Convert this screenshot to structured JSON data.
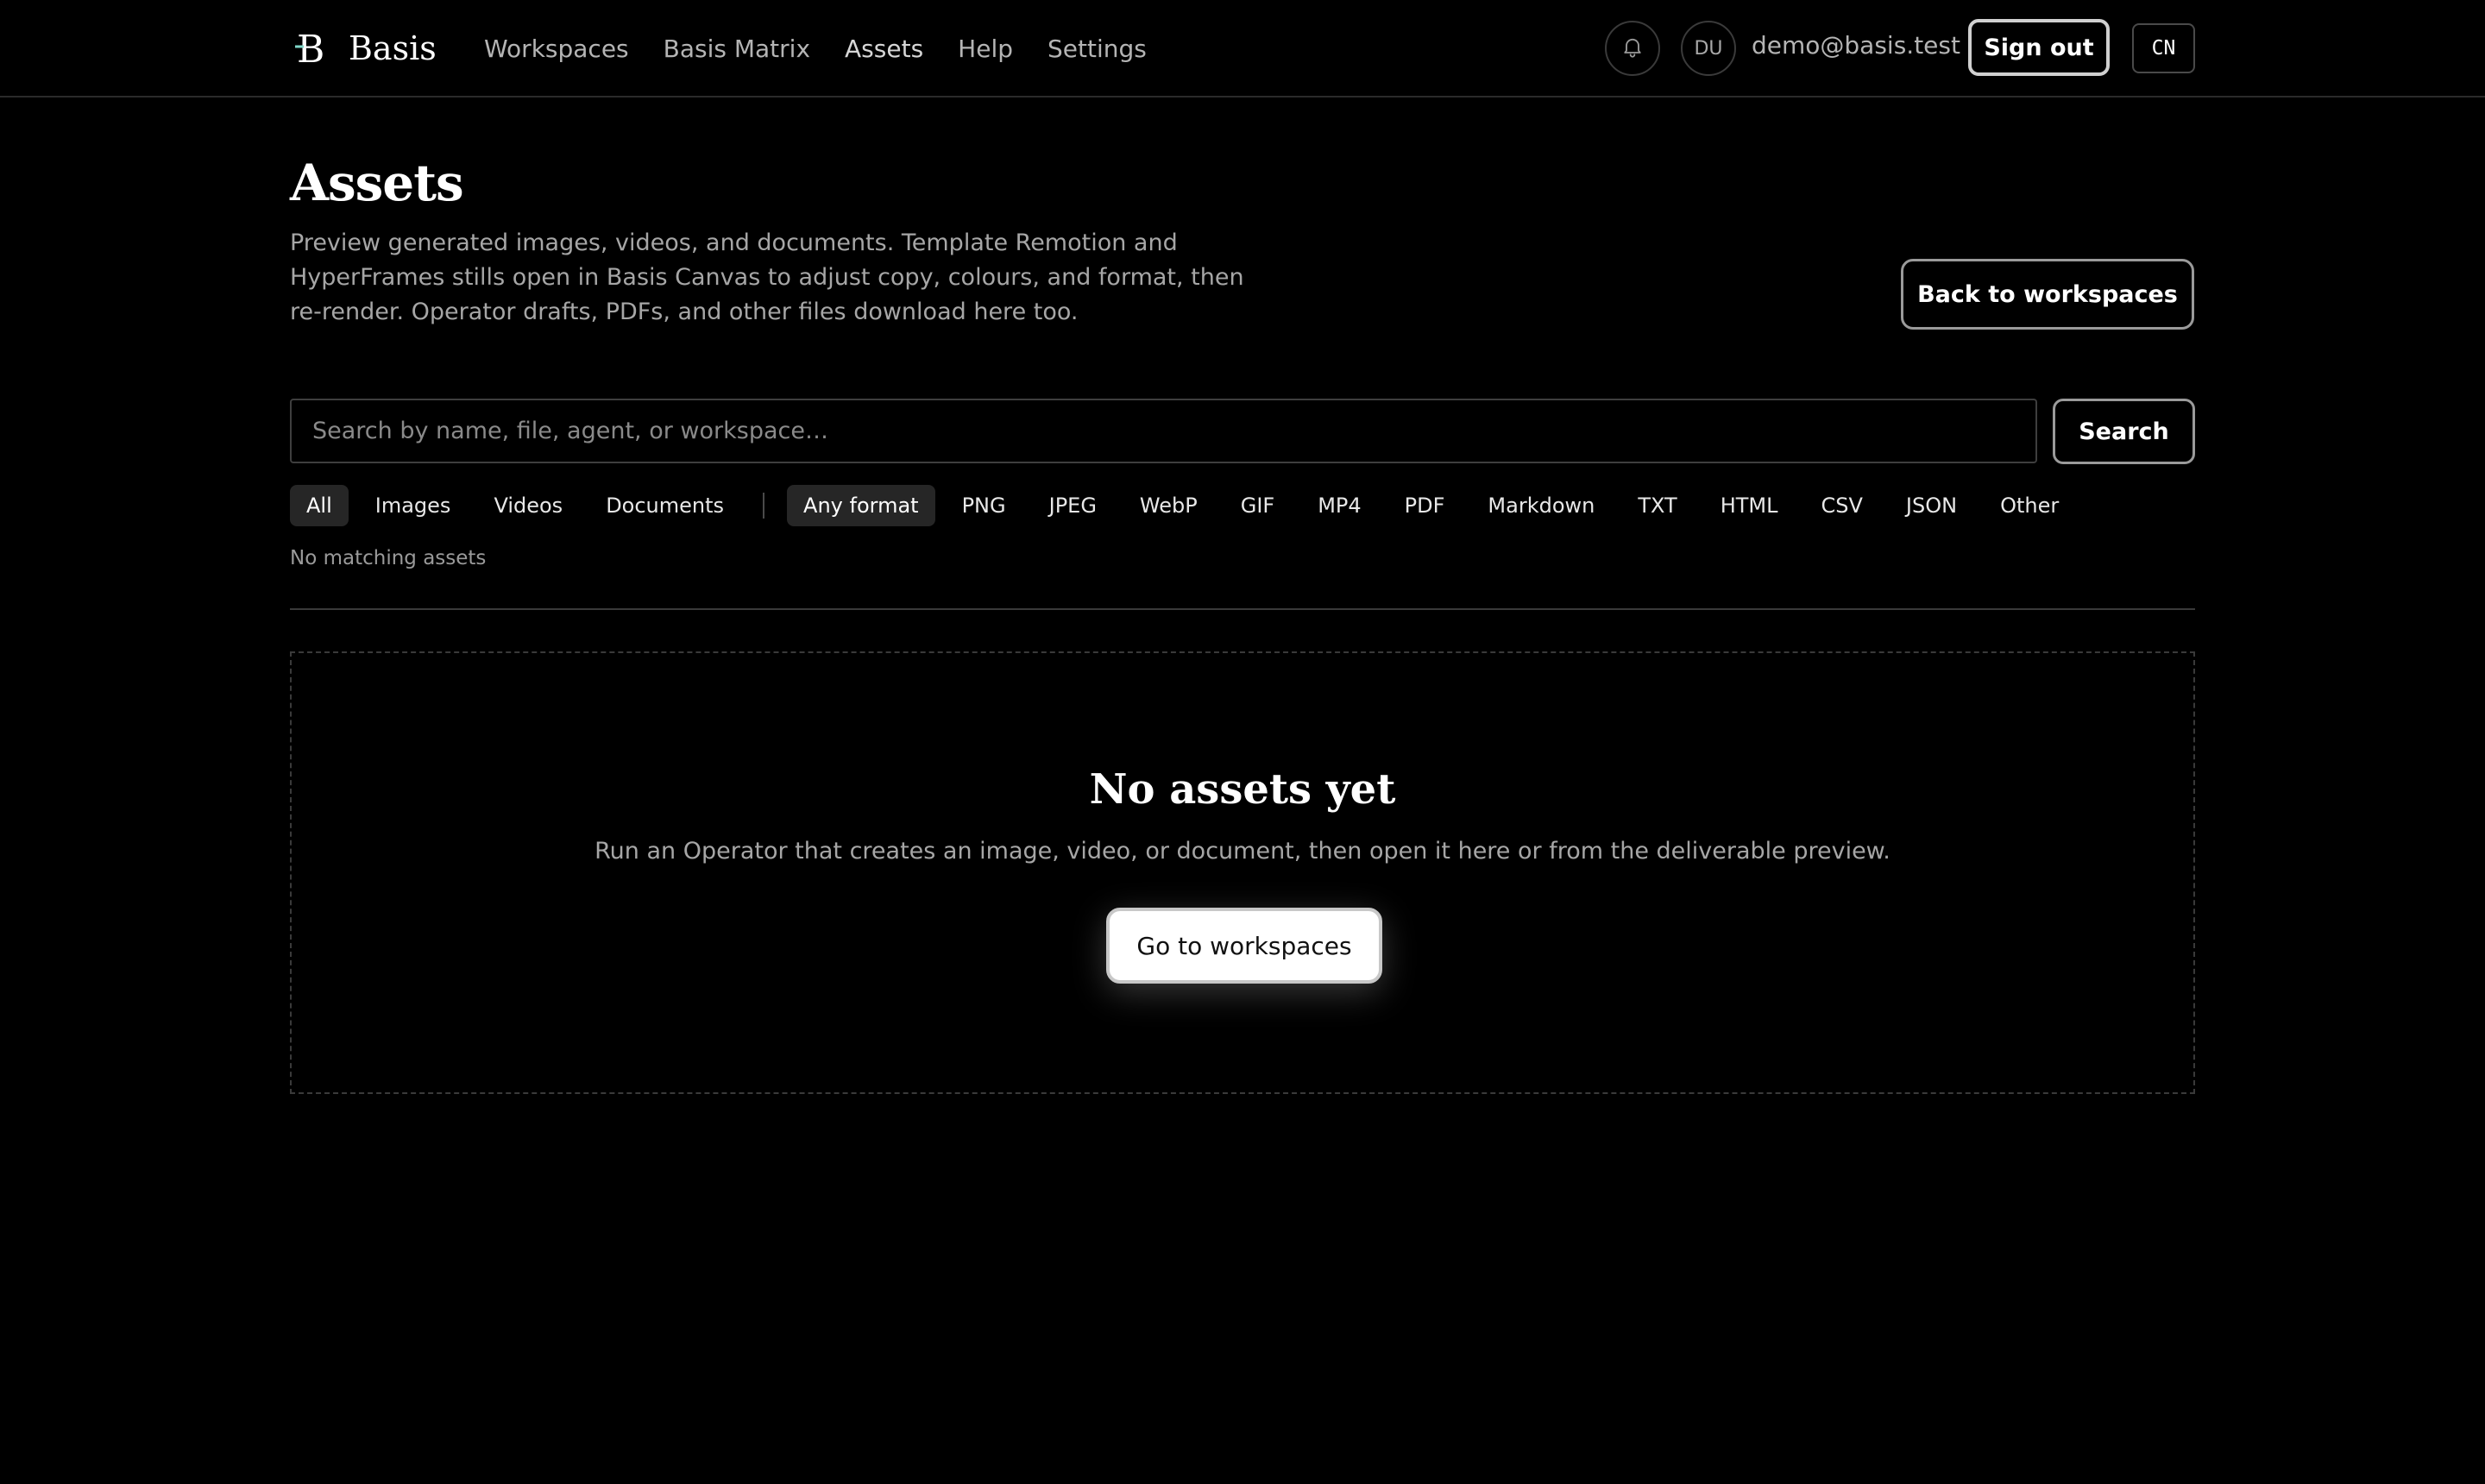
{
  "header": {
    "brand": {
      "logo_letter": "B",
      "name": "Basis",
      "logo_icon": "brand-b-icon"
    },
    "nav": [
      {
        "label": "Workspaces",
        "active": false
      },
      {
        "label": "Basis Matrix",
        "active": false
      },
      {
        "label": "Assets",
        "active": true
      },
      {
        "label": "Help",
        "active": false
      },
      {
        "label": "Settings",
        "active": false
      }
    ],
    "notifications_icon": "bell-icon",
    "avatar_initials": "DU",
    "user_email": "demo@basis.test",
    "sign_out_label": "Sign out",
    "language_label": "CN"
  },
  "page": {
    "title": "Assets",
    "description": "Preview generated images, videos, and documents. Template Remotion and HyperFrames stills open in Basis Canvas to adjust copy, colours, and format, then re-render. Operator drafts, PDFs, and other files download here too.",
    "back_button_label": "Back to workspaces"
  },
  "search": {
    "placeholder": "Search by name, file, agent, or workspace…",
    "value": "",
    "button_label": "Search"
  },
  "filters": {
    "types": [
      {
        "label": "All",
        "selected": true
      },
      {
        "label": "Images",
        "selected": false
      },
      {
        "label": "Videos",
        "selected": false
      },
      {
        "label": "Documents",
        "selected": false
      }
    ],
    "formats": [
      {
        "label": "Any format",
        "selected": true
      },
      {
        "label": "PNG",
        "selected": false
      },
      {
        "label": "JPEG",
        "selected": false
      },
      {
        "label": "WebP",
        "selected": false
      },
      {
        "label": "GIF",
        "selected": false
      },
      {
        "label": "MP4",
        "selected": false
      },
      {
        "label": "PDF",
        "selected": false
      },
      {
        "label": "Markdown",
        "selected": false
      },
      {
        "label": "TXT",
        "selected": false
      },
      {
        "label": "HTML",
        "selected": false
      },
      {
        "label": "CSV",
        "selected": false
      },
      {
        "label": "JSON",
        "selected": false
      },
      {
        "label": "Other",
        "selected": false
      }
    ],
    "result_text": "No matching assets"
  },
  "empty_state": {
    "title": "No assets yet",
    "description": "Run an Operator that creates an image, video, or document, then open it here or from the deliverable preview.",
    "button_label": "Go to workspaces"
  },
  "colors": {
    "background": "#000000",
    "text": "#ffffff",
    "muted_text": "#a6a6a6",
    "border": "#3a3a3a",
    "chip_selected_bg": "#262626",
    "primary_button_bg": "#ffffff"
  }
}
